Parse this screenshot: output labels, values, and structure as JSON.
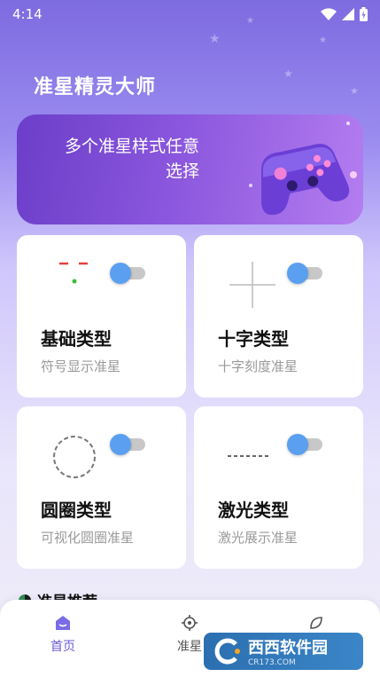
{
  "status_bar": {
    "time": "4:14"
  },
  "header": {
    "title": "准星精灵大师"
  },
  "banner": {
    "text": "多个准星样式任意选择",
    "image_icon": "gamepad-icon"
  },
  "cards": [
    {
      "title": "基础类型",
      "desc": "符号显示准星",
      "preview_icon": "basic-crosshair-icon",
      "toggle_on": true
    },
    {
      "title": "十字类型",
      "desc": "十字刻度准星",
      "preview_icon": "cross-crosshair-icon",
      "toggle_on": true
    },
    {
      "title": "圆圈类型",
      "desc": "可视化圆圈准星",
      "preview_icon": "circle-crosshair-icon",
      "toggle_on": true
    },
    {
      "title": "激光类型",
      "desc": "激光展示准星",
      "preview_icon": "laser-crosshair-icon",
      "toggle_on": true
    }
  ],
  "section_peek": {
    "label": "准星推荐"
  },
  "tabbar": {
    "tabs": [
      {
        "label": "首页",
        "icon": "home-icon",
        "active": true
      },
      {
        "label": "准星",
        "icon": "crosshair-icon",
        "active": false
      },
      {
        "label": "",
        "icon": "leaf-icon",
        "active": false
      }
    ]
  },
  "watermark": {
    "text": "西西软件园",
    "sub": "CR173.COM"
  },
  "colors": {
    "accent": "#5a9ff0",
    "primary": "#7d6be0",
    "tab_active": "#6a5ad8"
  }
}
